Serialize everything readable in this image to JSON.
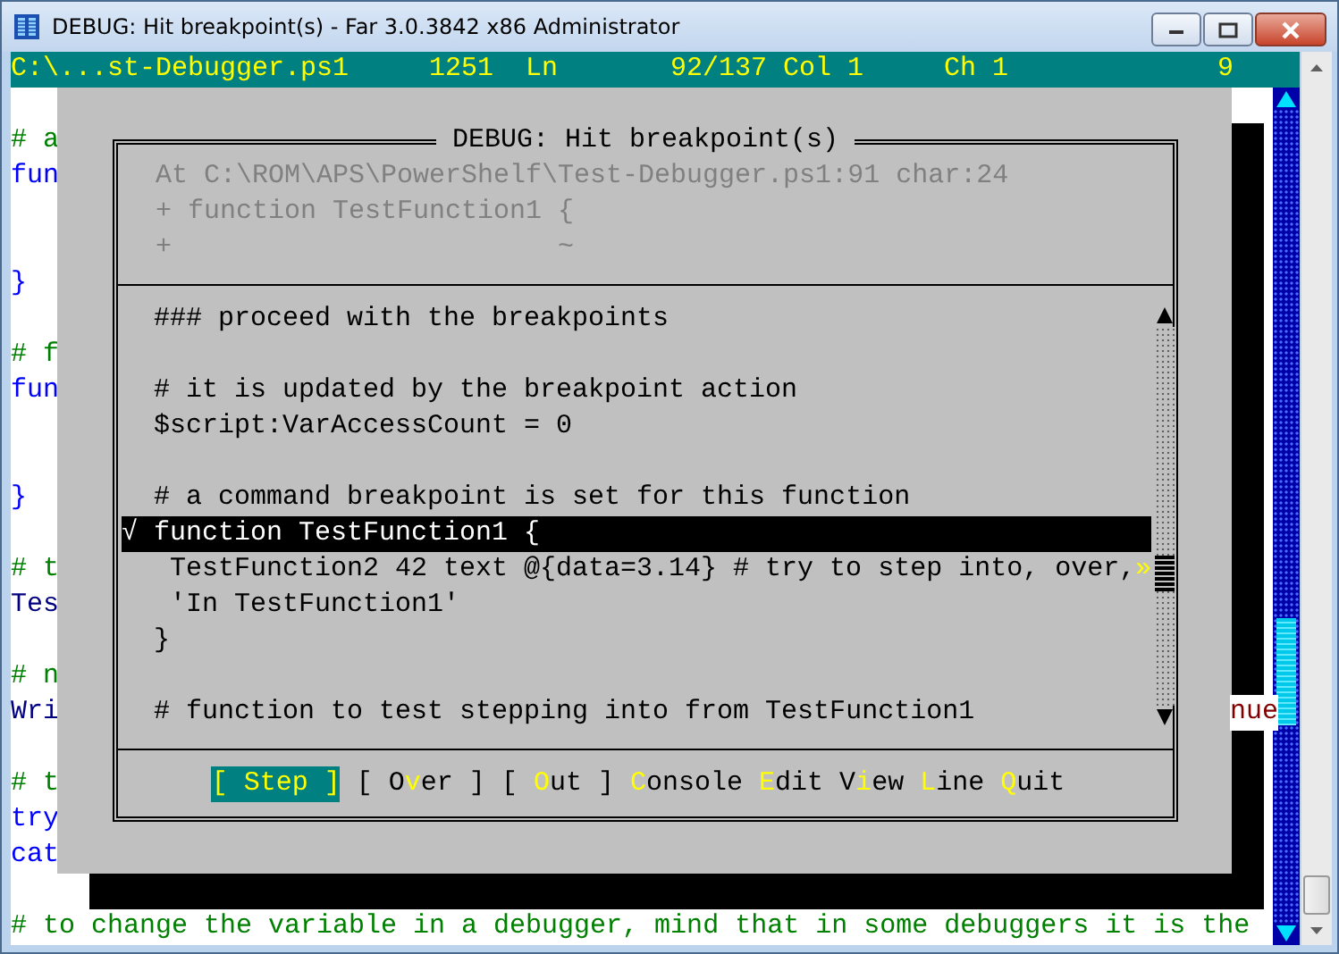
{
  "window": {
    "title": "DEBUG: Hit breakpoint(s) - Far 3.0.3842 x86 Administrator"
  },
  "status_line": {
    "file": "C:\\...st-Debugger.ps1",
    "size": "1251",
    "line_label": "Ln",
    "line": "92/137",
    "column": "Col 1",
    "char": "Ch 1",
    "code": "9"
  },
  "editor": {
    "lines": [
      {
        "kind": "blank"
      },
      {
        "kind": "comment",
        "text": "# a"
      },
      {
        "kind": "keyword",
        "text": "fun"
      },
      {
        "kind": "blank"
      },
      {
        "kind": "blank"
      },
      {
        "kind": "keyword",
        "text": "}"
      },
      {
        "kind": "blank"
      },
      {
        "kind": "comment",
        "text": "# f"
      },
      {
        "kind": "keyword",
        "text": "fun"
      },
      {
        "kind": "blank"
      },
      {
        "kind": "blank"
      },
      {
        "kind": "keyword",
        "text": "}"
      },
      {
        "kind": "blank"
      },
      {
        "kind": "comment",
        "text": "# t"
      },
      {
        "kind": "command",
        "text": "Tes"
      },
      {
        "kind": "blank"
      },
      {
        "kind": "comment",
        "text": "# n"
      },
      {
        "kind": "command",
        "text": "Wri",
        "right": "nue"
      },
      {
        "kind": "blank"
      },
      {
        "kind": "comment",
        "text": "# t"
      },
      {
        "kind": "keyword",
        "text": "try"
      },
      {
        "kind": "keyword",
        "text": "cat"
      },
      {
        "kind": "blank"
      },
      {
        "kind": "comment",
        "text": "# to change the variable in a debugger, mind that in some debuggers it is the"
      }
    ]
  },
  "dialog": {
    "title": "DEBUG: Hit breakpoint(s)",
    "location": [
      "At C:\\ROM\\APS\\PowerShelf\\Test-Debugger.ps1:91 char:24",
      "+ function TestFunction1 {",
      "+                        ~"
    ],
    "listing": [
      {
        "kind": "code",
        "text": "### proceed with the breakpoints",
        "selected": false
      },
      {
        "kind": "blank",
        "selected": false
      },
      {
        "kind": "code",
        "text": "# it is updated by the breakpoint action",
        "selected": false
      },
      {
        "kind": "code",
        "text": "$script:VarAccessCount = 0",
        "selected": false
      },
      {
        "kind": "blank",
        "selected": false
      },
      {
        "kind": "code",
        "text": "# a command breakpoint is set for this function",
        "selected": false
      },
      {
        "kind": "code",
        "marker": "√",
        "text": "function TestFunction1 {",
        "selected": true
      },
      {
        "kind": "body",
        "text": "TestFunction2 42 text @{data=3.14} # try to step into, over,",
        "overflow": "»",
        "selected": false
      },
      {
        "kind": "body",
        "text": "'In TestFunction1'",
        "selected": false
      },
      {
        "kind": "code",
        "text": "}",
        "selected": false
      },
      {
        "kind": "blank",
        "selected": false
      },
      {
        "kind": "code",
        "text": "# function to test stepping into from TestFunction1",
        "selected": false
      }
    ],
    "buttons": [
      {
        "prefix": "[ ",
        "hotkey": "S",
        "suffix": "tep ]",
        "selected": true
      },
      {
        "prefix": "[ O",
        "hotkey": "v",
        "suffix": "er ]",
        "selected": false
      },
      {
        "prefix": "[ ",
        "hotkey": "O",
        "suffix": "ut ]",
        "selected": false
      },
      {
        "hotkey": "C",
        "suffix": "onsole",
        "selected": false
      },
      {
        "hotkey": "E",
        "suffix": "dit",
        "selected": false
      },
      {
        "prefix": "V",
        "hotkey": "i",
        "suffix": "ew",
        "selected": false
      },
      {
        "hotkey": "L",
        "suffix": "ine",
        "selected": false
      },
      {
        "hotkey": "Q",
        "suffix": "uit",
        "selected": false
      }
    ]
  }
}
